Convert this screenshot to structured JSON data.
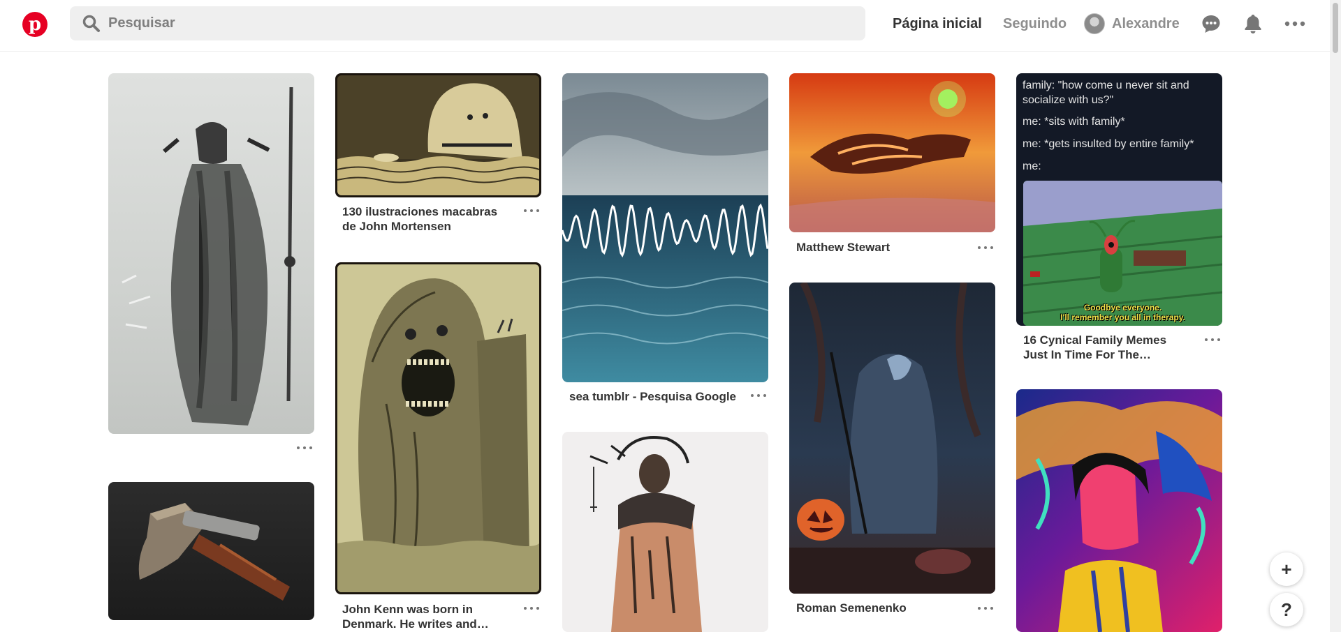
{
  "header": {
    "logo_letter": "p",
    "search_placeholder": "Pesquisar",
    "nav_home": "Página inicial",
    "nav_following": "Seguindo",
    "user_name": "Alexandre",
    "icons": [
      "chat-icon",
      "bell-icon",
      "more-icon"
    ]
  },
  "colors": {
    "brand": "#e60023",
    "search_bg": "#efefef"
  },
  "pins": {
    "p1": {
      "title": "",
      "icon": "more-icon"
    },
    "p2": {
      "title": ""
    },
    "p3": {
      "title": "130 ilustraciones macabras de John Mortensen"
    },
    "p4": {
      "title": "John Kenn was born in Denmark. He writes and…"
    },
    "p5": {
      "title": "sea tumblr - Pesquisa Google"
    },
    "p6": {
      "title": ""
    },
    "p7": {
      "title": "Matthew Stewart"
    },
    "p8": {
      "title": "Roman Semenenko"
    },
    "p9": {
      "title": "16 Cynical Family Memes Just In Time For The…",
      "meme_lines": [
        "family: \"how come u never sit and socialize with us?\"",
        "me: *sits with family*",
        "me: *gets insulted by entire family*",
        "me:"
      ],
      "caption_1": "Goodbye everyone.",
      "caption_2": "I'll remember you all in therapy."
    },
    "p10": {
      "title": ""
    }
  },
  "fab": {
    "add": "+",
    "help": "?"
  }
}
